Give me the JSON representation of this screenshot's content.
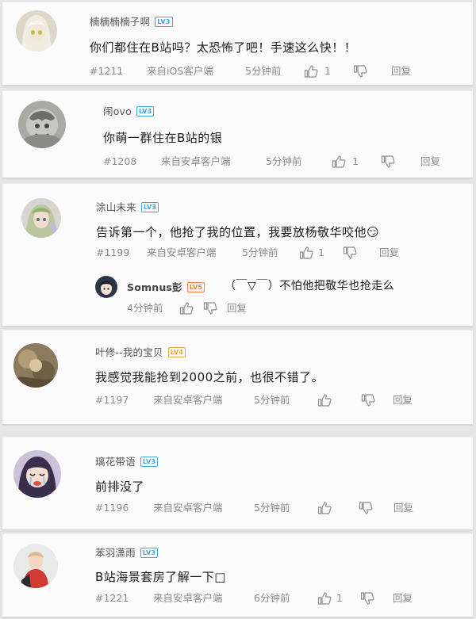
{
  "comments": [
    {
      "username": "楠楠楠楠子啊",
      "level": "LV3",
      "text": "你们都住在B站吗？太恐怖了吧！手速这么快！！",
      "floor": "#1211",
      "source": "来自iOS客户端",
      "time": "5分钟前",
      "likes": "1",
      "reply_label": "回复",
      "avatar": "anime-girl-white-hair-avatar"
    },
    {
      "username": "闹ovo",
      "level": "LV3",
      "text": "你萌一群住在B站的银",
      "floor": "#1208",
      "source": "来自安卓客户端",
      "time": "5分钟前",
      "likes": "1",
      "reply_label": "回复",
      "avatar": "grey-sketch-avatar"
    },
    {
      "username": "涂山未来",
      "level": "LV3",
      "text": "告诉第一个，他抢了我的位置，我要放杨敬华咬他😏",
      "floor": "#1199",
      "source": "来自安卓客户端",
      "time": "5分钟前",
      "likes": "1",
      "reply_label": "回复",
      "avatar": "anime-green-avatar",
      "reply": {
        "username": "Somnus彭",
        "level": "LV5",
        "text": "（￣▽￣）不怕他把敬华也抢走么",
        "time": "4分钟前",
        "reply_label": "回复",
        "avatar": "dark-hair-avatar"
      }
    },
    {
      "username": "叶修--我的宝贝",
      "level": "LV4",
      "text": "我感觉我能抢到2000之前，也很不错了。",
      "floor": "#1197",
      "source": "来自安卓客户端",
      "time": "5分钟前",
      "likes": "",
      "reply_label": "回复",
      "avatar": "brown-blur-avatar"
    },
    {
      "username": "璃花带语",
      "level": "LV3",
      "text": "前排没了",
      "floor": "#1196",
      "source": "来自安卓客户端",
      "time": "5分钟前",
      "likes": "",
      "reply_label": "回复",
      "avatar": "crying-anime-avatar"
    },
    {
      "username": "苯羽潇雨",
      "level": "LV3",
      "text": "B站海景套房了解一下□",
      "floor": "#1221",
      "source": "来自安卓客户端",
      "time": "6分钟前",
      "likes": "1",
      "reply_label": "回复",
      "avatar": "red-shirt-boy-avatar"
    }
  ],
  "colors": {
    "lv3": "#3ea8dd",
    "lv4": "#f0a242",
    "lv5": "#ff7a37",
    "meta": "#8c8c8c",
    "card": "#fbfbfb",
    "background": "#e6e6e6"
  },
  "icons": [
    "thumb-up-icon",
    "thumb-down-icon"
  ]
}
